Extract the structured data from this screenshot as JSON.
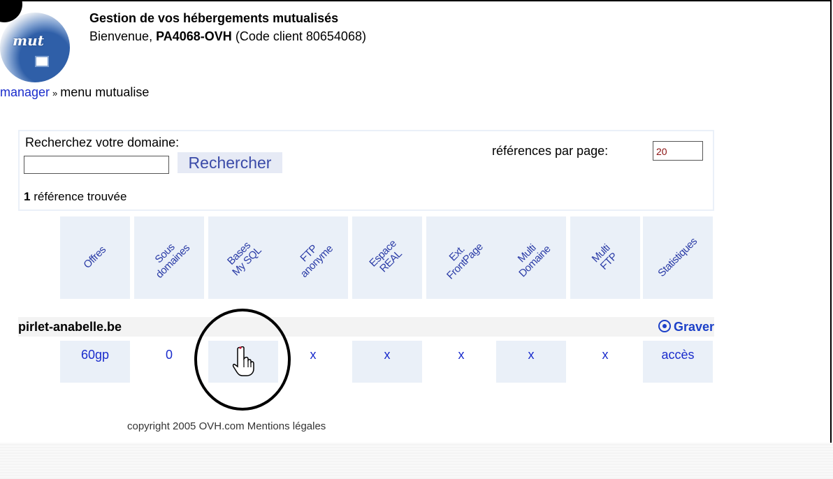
{
  "header": {
    "title": "Gestion de vos hébergements mutualisés",
    "welcome_prefix": "Bienvenue,",
    "account_id": "PA4068-OVH",
    "client_code": "(Code client 80654068)"
  },
  "logo": {
    "text": "mut"
  },
  "breadcrumb": {
    "link": "manager",
    "separator": "»",
    "current": "menu mutualise"
  },
  "search": {
    "label": "Recherchez votre domaine:",
    "input_value": "",
    "button_label": "Rechercher",
    "refs_label": "références par page:",
    "refs_value": "20",
    "found_count": "1",
    "found_text": "référence trouvée"
  },
  "columns": [
    {
      "label": "Offres"
    },
    {
      "label": "Sous\ndomaines"
    },
    {
      "label": "Bases\nMy SQL"
    },
    {
      "label": "FTP\nanonyme"
    },
    {
      "label": "Espace\nREAL"
    },
    {
      "label": "Ext.\nFrontPage"
    },
    {
      "label": "Multi\nDomaine"
    },
    {
      "label": "Multi\nFTP"
    },
    {
      "label": "Statistiques"
    }
  ],
  "domain": {
    "name": "pirlet-anabelle.be",
    "graver_label": "Graver",
    "cells": [
      "60gp",
      "0",
      "",
      "x",
      "x",
      "x",
      "x",
      "x",
      "accès"
    ]
  },
  "footer": {
    "copyright": "copyright 2005 OVH.com  Mentions légales"
  },
  "colors": {
    "link": "#1a2ccc",
    "header_bg": "#eaf0f8",
    "graver": "#1c40c8"
  }
}
